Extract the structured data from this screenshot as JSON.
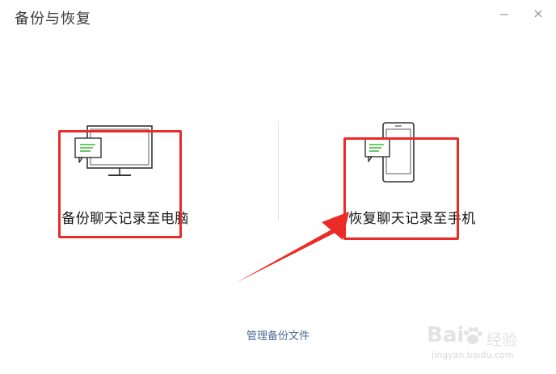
{
  "window": {
    "title": "备份与恢复",
    "minimize_icon": "minimize-icon",
    "close_icon": "close-icon"
  },
  "options": [
    {
      "label": "备份聊天记录至电脑",
      "icon": "monitor-chat-icon"
    },
    {
      "label": "恢复聊天记录至手机",
      "icon": "phone-chat-icon"
    }
  ],
  "manage_link": "管理备份文件",
  "watermark": {
    "brand": "Bai",
    "cn": "经验",
    "url": "jingyan.baidu.com"
  },
  "colors": {
    "annotation_red": "#ea2b27",
    "chat_green": "#5bbf57",
    "link_blue": "#4a6c94"
  }
}
